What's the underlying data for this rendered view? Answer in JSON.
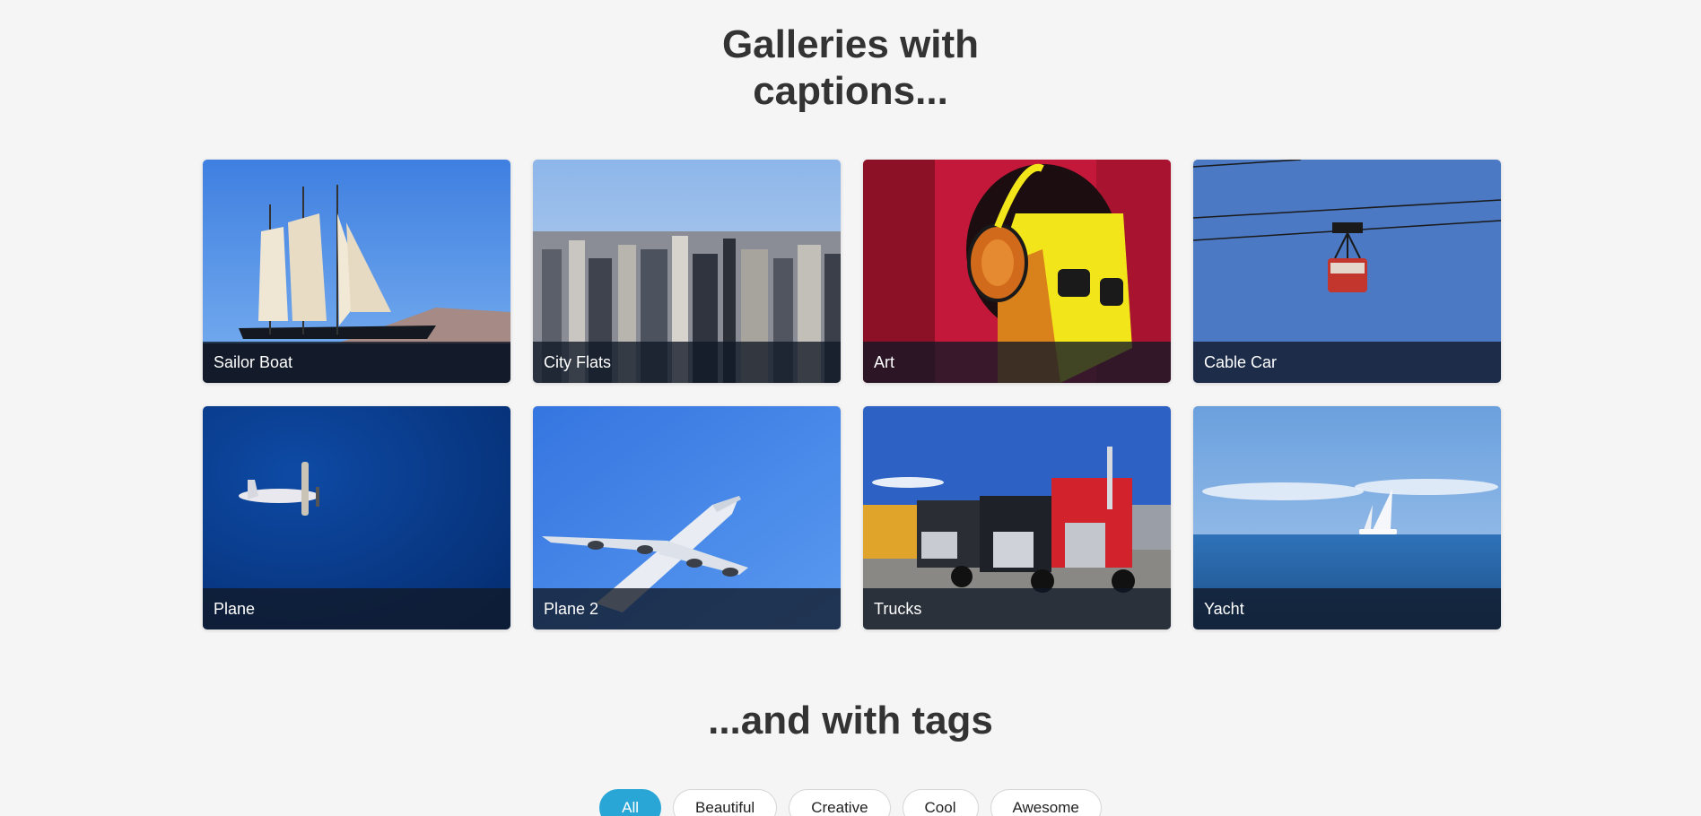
{
  "section1": {
    "title_line1": "Galleries with",
    "title_line2": "captions..."
  },
  "gallery": [
    {
      "caption": "Sailor Boat",
      "icon": "sailboat-photo"
    },
    {
      "caption": "City Flats",
      "icon": "city-skyline-photo"
    },
    {
      "caption": "Art",
      "icon": "headphones-art-photo"
    },
    {
      "caption": "Cable Car",
      "icon": "cable-car-photo"
    },
    {
      "caption": "Plane",
      "icon": "small-plane-photo"
    },
    {
      "caption": "Plane 2",
      "icon": "airliner-photo"
    },
    {
      "caption": "Trucks",
      "icon": "trucks-photo"
    },
    {
      "caption": "Yacht",
      "icon": "yacht-photo"
    }
  ],
  "section2": {
    "title": "...and with tags"
  },
  "tags": [
    {
      "label": "All",
      "active": true
    },
    {
      "label": "Beautiful",
      "active": false
    },
    {
      "label": "Creative",
      "active": false
    },
    {
      "label": "Cool",
      "active": false
    },
    {
      "label": "Awesome",
      "active": false
    }
  ],
  "colors": {
    "accent": "#2aa6d6",
    "background": "#f5f5f5",
    "caption_bar": "#111827"
  }
}
